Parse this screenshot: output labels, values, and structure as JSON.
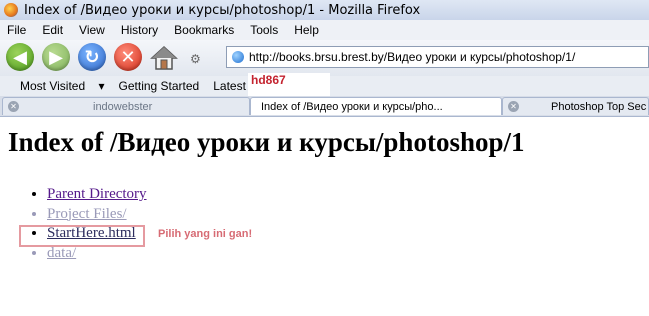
{
  "window": {
    "title": "Index of /Видео уроки и курсы/photoshop/1 - Mozilla Firefox"
  },
  "menu": [
    "File",
    "Edit",
    "View",
    "History",
    "Bookmarks",
    "Tools",
    "Help"
  ],
  "nav": {
    "url": "http://books.brsu.brest.by/Видео уроки и курсы/photoshop/1/",
    "icons": [
      "back-icon",
      "forward-icon",
      "reload-icon",
      "stop-icon",
      "home-icon",
      "globe-icon"
    ]
  },
  "bookmarks": {
    "most_visited": "Most Visited",
    "getting_started": "Getting Started",
    "latest_headlines": "Latest Head"
  },
  "watermark": {
    "text": "hd867"
  },
  "tabs": [
    {
      "label": "indowebster"
    },
    {
      "label": "Index of /Видео уроки и курсы/pho..."
    },
    {
      "label": "Photoshop Top Sec"
    }
  ],
  "page": {
    "heading": "Index of /Видео уроки и курсы/photoshop/1",
    "items": [
      {
        "label": "Parent Directory"
      },
      {
        "label": "Project Files/"
      },
      {
        "label": "StartHere.html"
      },
      {
        "label": "data/"
      }
    ],
    "annotation": "Pilih yang ini gan!"
  },
  "colors": {
    "visited_link": "#551a8b",
    "faded_link": "#9a9ab8",
    "annotation": "#d76b74",
    "watermark": "#c4232f"
  }
}
